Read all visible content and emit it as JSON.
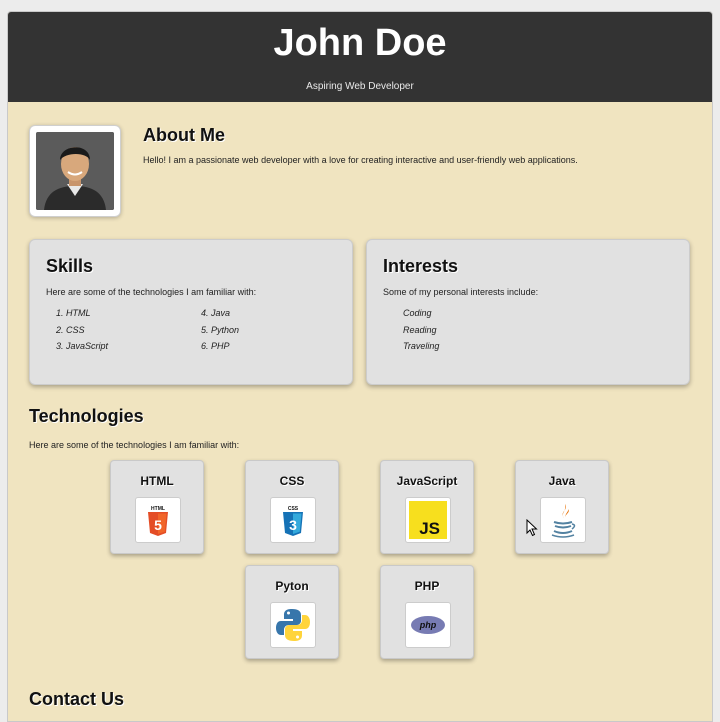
{
  "header": {
    "name": "John Doe",
    "subtitle": "Aspiring Web Developer"
  },
  "about": {
    "title": "About Me",
    "text": "Hello! I am a passionate web developer with a love for creating interactive and user-friendly web applications."
  },
  "skills": {
    "title": "Skills",
    "intro": "Here are some of the technologies I am familiar with:",
    "items": [
      "HTML",
      "CSS",
      "JavaScript",
      "Java",
      "Python",
      "PHP"
    ]
  },
  "interests": {
    "title": "Interests",
    "intro": "Some of my personal interests include:",
    "items": [
      "Coding",
      "Reading",
      "Traveling"
    ]
  },
  "technologies": {
    "title": "Technologies",
    "intro": "Here are some of the technologies I am familiar with:",
    "items": [
      {
        "name": "HTML",
        "icon": "html5-icon"
      },
      {
        "name": "CSS",
        "icon": "css3-icon"
      },
      {
        "name": "JavaScript",
        "icon": "javascript-icon"
      },
      {
        "name": "Java",
        "icon": "java-icon"
      },
      {
        "name": "Pyton",
        "icon": "python-icon"
      },
      {
        "name": "PHP",
        "icon": "php-icon"
      }
    ]
  },
  "contact": {
    "title": "Contact Us"
  },
  "colors": {
    "header_bg": "#333333",
    "page_bg": "#f0e4c0",
    "card_bg": "#e1e1e1",
    "html_orange": "#e44d26",
    "css_blue": "#1572b6",
    "js_yellow": "#f7df1e",
    "php_purple": "#777bb3"
  }
}
